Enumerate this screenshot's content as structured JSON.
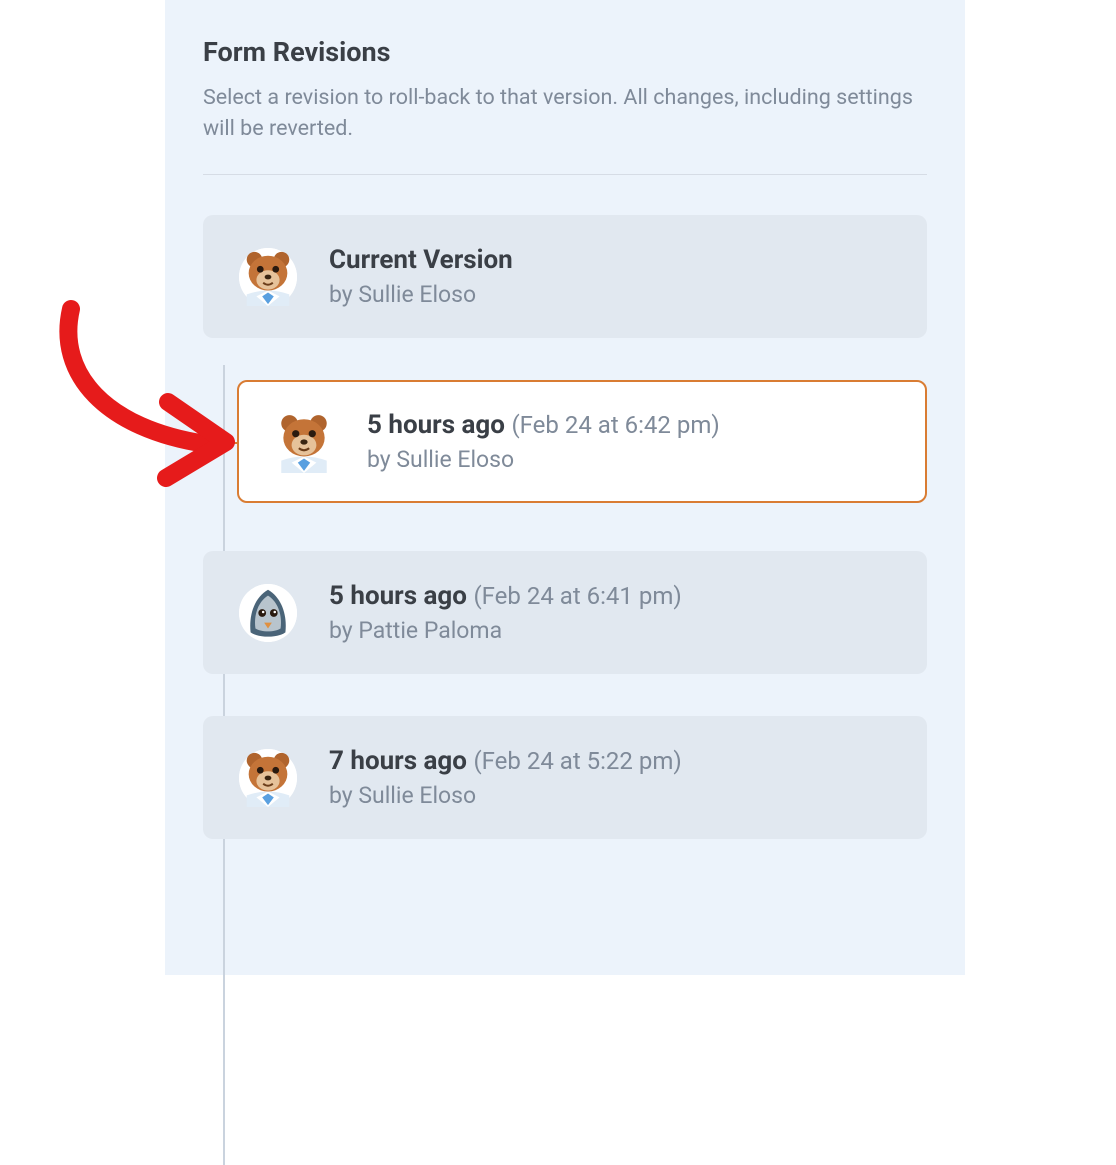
{
  "header": {
    "title": "Form Revisions",
    "description": "Select a revision to roll-back to that version. All changes, including settings will be reverted."
  },
  "revisions": [
    {
      "title": "Current Version",
      "timestamp": "",
      "author_line": "by Sullie Eloso",
      "avatar": "bear",
      "selected": false
    },
    {
      "title": "5 hours ago",
      "timestamp": "(Feb 24 at 6:42 pm)",
      "author_line": "by Sullie Eloso",
      "avatar": "bear",
      "selected": true
    },
    {
      "title": "5 hours ago",
      "timestamp": "(Feb 24 at 6:41 pm)",
      "author_line": "by Pattie Paloma",
      "avatar": "pigeon",
      "selected": false
    },
    {
      "title": "7 hours ago",
      "timestamp": "(Feb 24 at 5:22 pm)",
      "author_line": "by Sullie Eloso",
      "avatar": "bear",
      "selected": false
    }
  ]
}
